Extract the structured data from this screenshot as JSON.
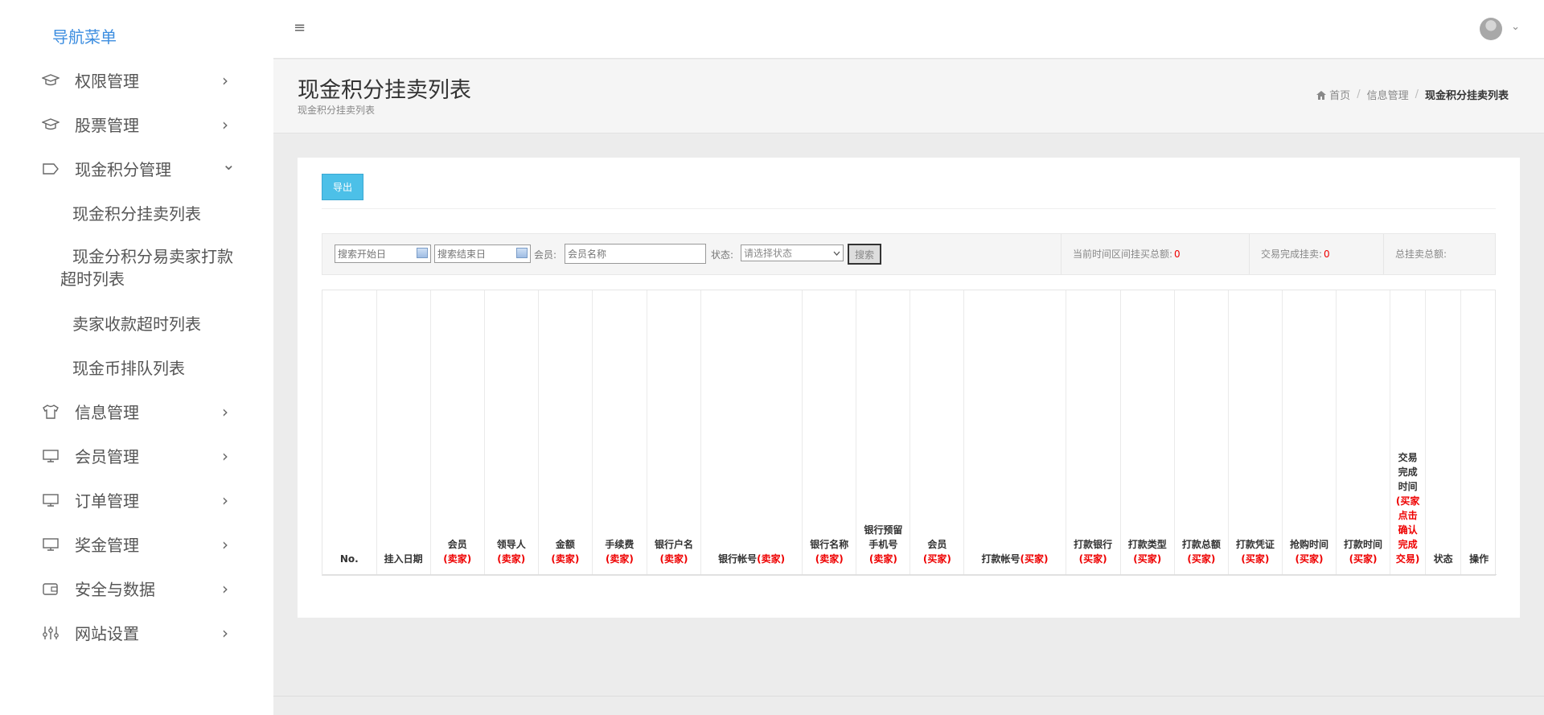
{
  "sidebar": {
    "title": "导航菜单",
    "items": [
      {
        "label": "权限管理",
        "icon": "mortarboard-icon",
        "chevron": "›"
      },
      {
        "label": "股票管理",
        "icon": "mortarboard-icon",
        "chevron": "›"
      },
      {
        "label": "现金积分管理",
        "icon": "tag-icon",
        "chevron": "⌄"
      },
      {
        "label": "信息管理",
        "icon": "shirt-icon",
        "chevron": "›"
      },
      {
        "label": "会员管理",
        "icon": "monitor-icon",
        "chevron": "›"
      },
      {
        "label": "订单管理",
        "icon": "monitor-icon",
        "chevron": "›"
      },
      {
        "label": "奖金管理",
        "icon": "monitor-icon",
        "chevron": "›"
      },
      {
        "label": "安全与数据",
        "icon": "wallet-icon",
        "chevron": "›"
      },
      {
        "label": "网站设置",
        "icon": "sliders-icon",
        "chevron": "›"
      }
    ],
    "subitems": [
      {
        "label": "现金积分挂卖列表"
      },
      {
        "label": "现金分积分易卖家打款超时列表"
      },
      {
        "label": "卖家收款超时列表"
      },
      {
        "label": "现金币排队列表"
      }
    ]
  },
  "header": {
    "menu_glyph": "≡",
    "avatar_caret": "⌄"
  },
  "page": {
    "title": "现金积分挂卖列表",
    "subtitle": "现金积分挂卖列表",
    "breadcrumb": {
      "home": "首页",
      "sep": "/",
      "section": "信息管理",
      "current": "现金积分挂卖列表"
    }
  },
  "toolbar": {
    "export_label": "导出"
  },
  "filters": {
    "start_placeholder": "搜索开始日",
    "end_placeholder": "搜索结束日",
    "member_label": "会员:",
    "member_placeholder": "会员名称",
    "status_label": "状态:",
    "status_selected": "请选择状态",
    "search_label": "搜索"
  },
  "stats": [
    {
      "label": "当前时间区间挂买总额:",
      "value": "0"
    },
    {
      "label": "交易完成挂卖:",
      "value": "0"
    },
    {
      "label": "总挂卖总额:",
      "value": ""
    }
  ],
  "table": {
    "columns": [
      {
        "label": "No.",
        "note": ""
      },
      {
        "label": "挂入日期",
        "note": ""
      },
      {
        "label": "会员",
        "note": "(卖家)"
      },
      {
        "label": "领导人",
        "note": "(卖家)"
      },
      {
        "label": "金额",
        "note": "(卖家)"
      },
      {
        "label": "手续费",
        "note": "(卖家)"
      },
      {
        "label": "银行户名",
        "note": "(卖家)"
      },
      {
        "label": "银行帐号",
        "note": "(卖家)"
      },
      {
        "label": "银行名称",
        "note": "(卖家)"
      },
      {
        "label": "银行预留手机号",
        "note": "(卖家)"
      },
      {
        "label": "会员",
        "note": "(买家)"
      },
      {
        "label": "打款帐号",
        "note": "(买家)"
      },
      {
        "label": "打款银行",
        "note": "(买家)"
      },
      {
        "label": "打款类型",
        "note": "(买家)"
      },
      {
        "label": "打款总额",
        "note": "(买家)"
      },
      {
        "label": "打款凭证",
        "note": "(买家)"
      },
      {
        "label": "抢购时间",
        "note": "(买家)"
      },
      {
        "label": "打款时间",
        "note": "(买家)"
      },
      {
        "label": "交易完成时间",
        "note": "(买家点击确认完成交易)"
      },
      {
        "label": "状态",
        "note": ""
      },
      {
        "label": "操作",
        "note": ""
      }
    ]
  },
  "colors": {
    "accent": "#3d8ee0",
    "export_button": "#4cc0e8",
    "value_red": "#e00000"
  }
}
